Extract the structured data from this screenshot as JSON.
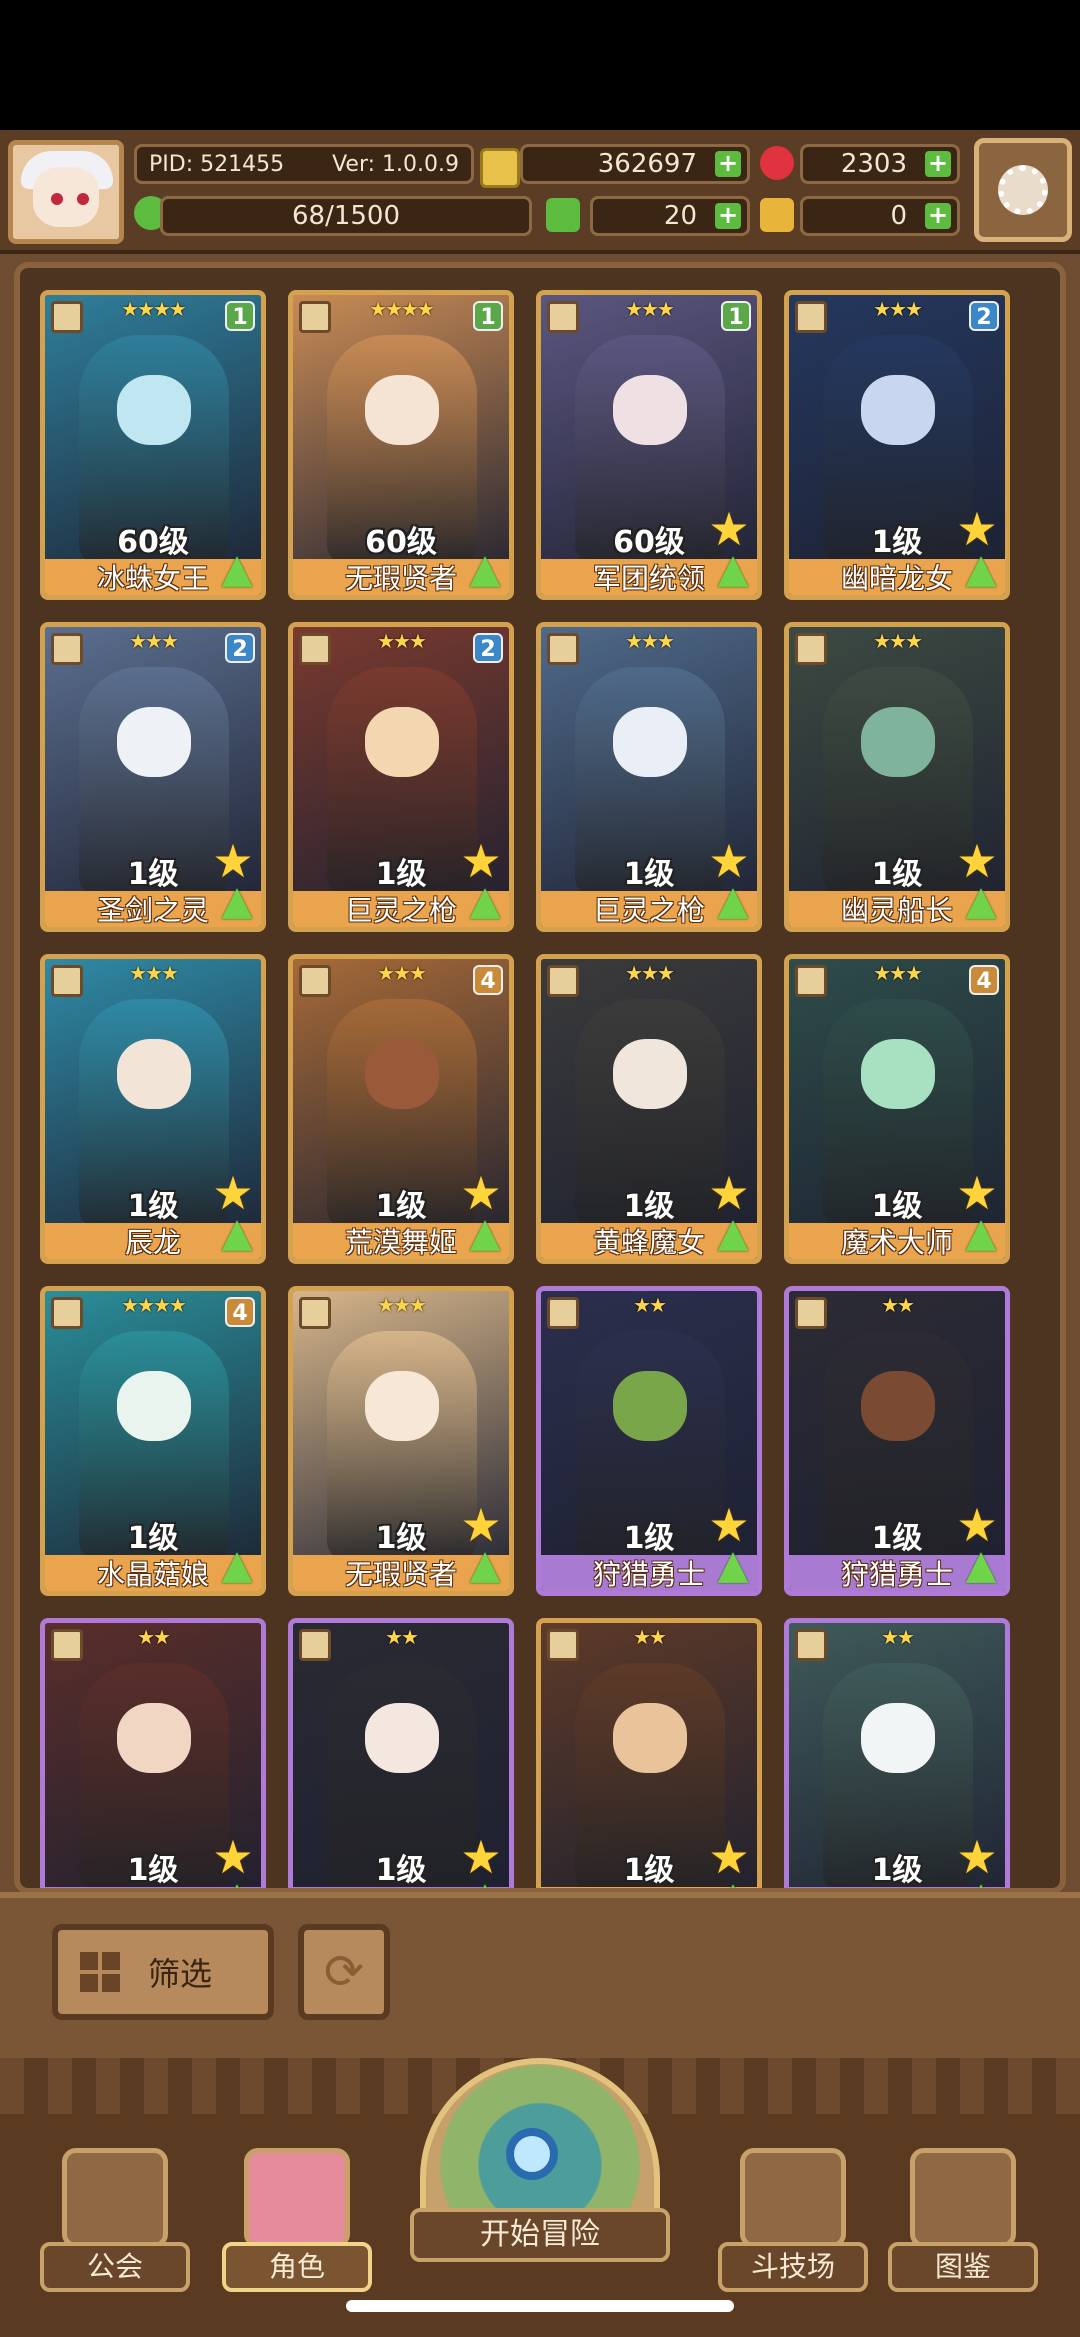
{
  "header": {
    "pid": "PID: 521455",
    "version": "Ver: 1.0.0.9",
    "gold": "362697",
    "gems": "2303",
    "exp": "68/1500",
    "clover": "20",
    "keys": "0"
  },
  "cards": [
    {
      "stars": "★★★★",
      "badge": "1",
      "badge_color": "#5aa84a",
      "level": "60级",
      "name": "冰蛛女王",
      "frame": "gold",
      "art": "#2f7f9c",
      "skin": "#bfe6f1",
      "big_star": false
    },
    {
      "stars": "★★★★",
      "badge": "1",
      "badge_color": "#5aa84a",
      "level": "60级",
      "name": "无瑕贤者",
      "frame": "gold",
      "art": "#c98b55",
      "skin": "#f5e3d3",
      "big_star": false
    },
    {
      "stars": "★★★",
      "badge": "1",
      "badge_color": "#5aa84a",
      "level": "60级",
      "name": "军团统领",
      "frame": "gold",
      "art": "#5b5680",
      "skin": "#efe1e3",
      "big_star": true
    },
    {
      "stars": "★★★",
      "badge": "2",
      "badge_color": "#3b87c8",
      "level": "1级",
      "name": "幽暗龙女",
      "frame": "gold",
      "art": "#24385f",
      "skin": "#c8d6ef",
      "big_star": true
    },
    {
      "stars": "★★★",
      "badge": "2",
      "badge_color": "#3b87c8",
      "level": "1级",
      "name": "圣剑之灵",
      "frame": "gold",
      "art": "#5b6f8f",
      "skin": "#eef1f6",
      "big_star": true
    },
    {
      "stars": "★★★",
      "badge": "2",
      "badge_color": "#3b87c8",
      "level": "1级",
      "name": "巨灵之枪",
      "frame": "gold",
      "art": "#7a3a2f",
      "skin": "#f2d7b1",
      "big_star": true
    },
    {
      "stars": "★★★",
      "badge": "",
      "badge_color": "",
      "level": "1级",
      "name": "巨灵之枪",
      "frame": "gold",
      "art": "#4f6a8a",
      "skin": "#e9eef7",
      "big_star": true
    },
    {
      "stars": "★★★",
      "badge": "",
      "badge_color": "",
      "level": "1级",
      "name": "幽灵船长",
      "frame": "gold",
      "art": "#3d4a42",
      "skin": "#7fb39c",
      "big_star": true
    },
    {
      "stars": "★★★",
      "badge": "",
      "badge_color": "",
      "level": "1级",
      "name": "辰龙",
      "frame": "gold",
      "art": "#2f8aa6",
      "skin": "#f2e4d6",
      "big_star": true
    },
    {
      "stars": "★★★",
      "badge": "4",
      "badge_color": "#c98a3a",
      "level": "1级",
      "name": "荒漠舞姬",
      "frame": "gold",
      "art": "#a66a38",
      "skin": "#9a5a3a",
      "big_star": true
    },
    {
      "stars": "★★★",
      "badge": "",
      "badge_color": "",
      "level": "1级",
      "name": "黄蜂魔女",
      "frame": "gold",
      "art": "#3b3b3b",
      "skin": "#f0e6db",
      "big_star": true
    },
    {
      "stars": "★★★",
      "badge": "4",
      "badge_color": "#c98a3a",
      "level": "1级",
      "name": "魔术大师",
      "frame": "gold",
      "art": "#2e4c4a",
      "skin": "#a8e0c2",
      "big_star": true
    },
    {
      "stars": "★★★★",
      "badge": "4",
      "badge_color": "#c98a3a",
      "level": "1级",
      "name": "水晶菇娘",
      "frame": "gold",
      "art": "#2a8e9a",
      "skin": "#eaf4ee",
      "big_star": false
    },
    {
      "stars": "★★★",
      "badge": "",
      "badge_color": "",
      "level": "1级",
      "name": "无瑕贤者",
      "frame": "gold",
      "art": "#d6b58a",
      "skin": "#f6e7d6",
      "big_star": true
    },
    {
      "stars": "★★",
      "badge": "",
      "badge_color": "",
      "level": "1级",
      "name": "狩猎勇士",
      "frame": "purple",
      "art": "#2b2f4d",
      "skin": "#7aa64a",
      "big_star": true
    },
    {
      "stars": "★★",
      "badge": "",
      "badge_color": "",
      "level": "1级",
      "name": "狩猎勇士",
      "frame": "purple",
      "art": "#2c2b35",
      "skin": "#7a4a33",
      "big_star": true
    },
    {
      "stars": "★★",
      "badge": "",
      "badge_color": "",
      "level": "1级",
      "name": "",
      "frame": "purple",
      "art": "#5a2e2a",
      "skin": "#f1d6c3",
      "big_star": true
    },
    {
      "stars": "★★",
      "badge": "",
      "badge_color": "",
      "level": "1级",
      "name": "",
      "frame": "purple",
      "art": "#2a2a33",
      "skin": "#f3e7df",
      "big_star": true
    },
    {
      "stars": "★★",
      "badge": "",
      "badge_color": "",
      "level": "1级",
      "name": "",
      "frame": "gold",
      "art": "#5e3a28",
      "skin": "#e9c39a",
      "big_star": true
    },
    {
      "stars": "★★",
      "badge": "",
      "badge_color": "",
      "level": "1级",
      "name": "",
      "frame": "purple",
      "art": "#3f5a5a",
      "skin": "#f2f5f6",
      "big_star": true
    }
  ],
  "filter": {
    "label": "筛选",
    "refresh_icon": "refresh-icon"
  },
  "nav": {
    "guild": "公会",
    "character": "角色",
    "adventure": "开始冒险",
    "arena": "斗技场",
    "codex": "图鉴"
  }
}
